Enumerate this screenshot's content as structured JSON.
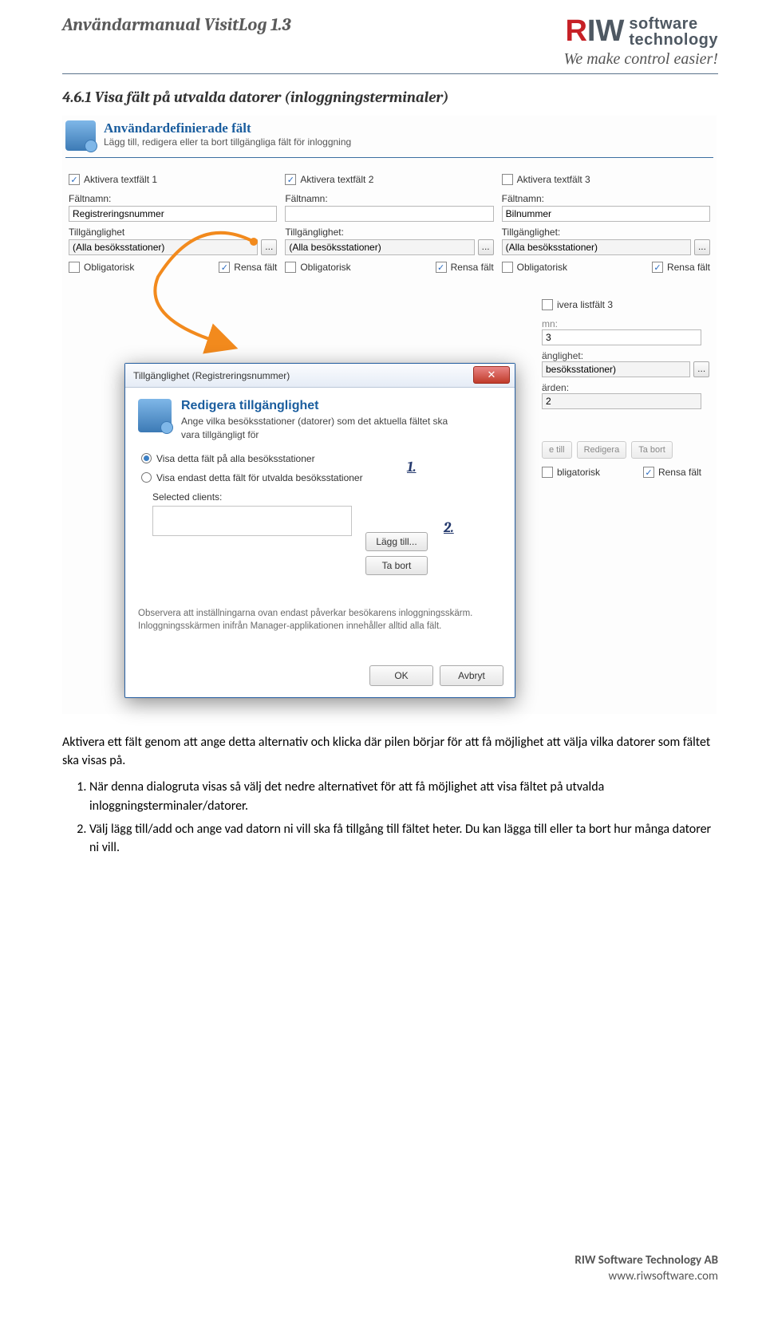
{
  "header": {
    "doc_title": "Användarmanual VisitLog 1.3",
    "logo": {
      "r": "R",
      "iw": "IW",
      "line1": "software",
      "line2": "technology",
      "tagline": "We make control easier!"
    }
  },
  "section": {
    "heading": "4.6.1  Visa fält på utvalda datorer (inloggningsterminaler)"
  },
  "panel": {
    "title": "Användardefinierade fält",
    "subtitle": "Lägg till, redigera eller ta bort tillgängliga fält för inloggning",
    "cols": [
      {
        "activate": "Aktivera textfält 1",
        "activate_checked": true,
        "name_label": "Fältnamn:",
        "name_value": "Registreringsnummer",
        "avail_label": "Tillgänglighet",
        "avail_value": "(Alla besöksstationer)",
        "oblig": "Obligatorisk",
        "oblig_checked": false,
        "rensa": "Rensa fält",
        "rensa_checked": true
      },
      {
        "activate": "Aktivera textfält 2",
        "activate_checked": true,
        "name_label": "Fältnamn:",
        "name_value": "",
        "avail_label": "Tillgänglighet:",
        "avail_value": "(Alla besöksstationer)",
        "oblig": "Obligatorisk",
        "oblig_checked": false,
        "rensa": "Rensa fält",
        "rensa_checked": true
      },
      {
        "activate": "Aktivera textfält 3",
        "activate_checked": false,
        "name_label": "Fältnamn:",
        "name_value": "Bilnummer",
        "avail_label": "Tillgänglighet:",
        "avail_value": "(Alla besöksstationer)",
        "oblig": "Obligatorisk",
        "oblig_checked": false,
        "rensa": "Rensa fält",
        "rensa_checked": true
      }
    ],
    "dots": "...",
    "list3": {
      "activate": "ivera listfält 3",
      "num": "3",
      "avail_frag": "änglighet:",
      "avail_val": "besöksstationer)",
      "arden": "ärden:",
      "val": "2",
      "btn1": "e till",
      "btn2": "Redigera",
      "btn3": "Ta bort",
      "oblig": "bligatorisk",
      "rensa": "Rensa fält"
    }
  },
  "modal": {
    "titlebar": "Tillgänglighet (Registreringsnummer)",
    "close": "✕",
    "title": "Redigera tillgänglighet",
    "sub": "Ange vilka besöksstationer (datorer) som det aktuella fältet ska vara tillgängligt för",
    "radio1": "Visa detta fält på alla besöksstationer",
    "radio2": "Visa endast detta fält för utvalda besöksstationer",
    "selected_label": "Selected clients:",
    "add": "Lägg till...",
    "remove": "Ta bort",
    "observe": "Observera att inställningarna ovan endast påverkar besökarens inloggningsskärm. Inloggningsskärmen inifrån Manager-applikationen innehåller alltid alla fält.",
    "ok": "OK",
    "cancel": "Avbryt"
  },
  "annotations": {
    "one": "1.",
    "two": "2."
  },
  "body": {
    "intro": "Aktivera ett fält genom att ange detta alternativ och klicka där pilen börjar för att få möjlighet att välja vilka datorer som fältet ska visas på.",
    "li1": "När denna dialogruta visas så välj det nedre alternativet för att få möjlighet att visa fältet på utvalda inloggningsterminaler/datorer.",
    "li2": "Välj lägg till/add och ange vad datorn ni vill ska få tillgång till fältet heter. Du kan lägga till eller ta bort hur många datorer ni vill."
  },
  "footer": {
    "company": "RIW Software Technology AB",
    "url": "www.riwsoftware.com"
  }
}
